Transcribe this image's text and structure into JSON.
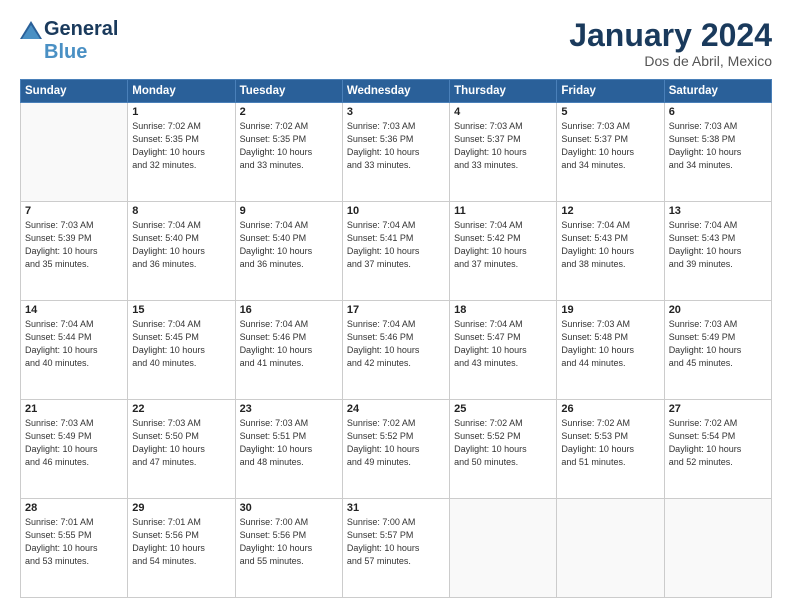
{
  "header": {
    "logo_general": "General",
    "logo_blue": "Blue",
    "month_title": "January 2024",
    "location": "Dos de Abril, Mexico"
  },
  "days_of_week": [
    "Sunday",
    "Monday",
    "Tuesday",
    "Wednesday",
    "Thursday",
    "Friday",
    "Saturday"
  ],
  "weeks": [
    [
      {
        "num": "",
        "sunrise": "",
        "sunset": "",
        "daylight": ""
      },
      {
        "num": "1",
        "sunrise": "Sunrise: 7:02 AM",
        "sunset": "Sunset: 5:35 PM",
        "daylight": "Daylight: 10 hours and 32 minutes."
      },
      {
        "num": "2",
        "sunrise": "Sunrise: 7:02 AM",
        "sunset": "Sunset: 5:35 PM",
        "daylight": "Daylight: 10 hours and 33 minutes."
      },
      {
        "num": "3",
        "sunrise": "Sunrise: 7:03 AM",
        "sunset": "Sunset: 5:36 PM",
        "daylight": "Daylight: 10 hours and 33 minutes."
      },
      {
        "num": "4",
        "sunrise": "Sunrise: 7:03 AM",
        "sunset": "Sunset: 5:37 PM",
        "daylight": "Daylight: 10 hours and 33 minutes."
      },
      {
        "num": "5",
        "sunrise": "Sunrise: 7:03 AM",
        "sunset": "Sunset: 5:37 PM",
        "daylight": "Daylight: 10 hours and 34 minutes."
      },
      {
        "num": "6",
        "sunrise": "Sunrise: 7:03 AM",
        "sunset": "Sunset: 5:38 PM",
        "daylight": "Daylight: 10 hours and 34 minutes."
      }
    ],
    [
      {
        "num": "7",
        "sunrise": "Sunrise: 7:03 AM",
        "sunset": "Sunset: 5:39 PM",
        "daylight": "Daylight: 10 hours and 35 minutes."
      },
      {
        "num": "8",
        "sunrise": "Sunrise: 7:04 AM",
        "sunset": "Sunset: 5:40 PM",
        "daylight": "Daylight: 10 hours and 36 minutes."
      },
      {
        "num": "9",
        "sunrise": "Sunrise: 7:04 AM",
        "sunset": "Sunset: 5:40 PM",
        "daylight": "Daylight: 10 hours and 36 minutes."
      },
      {
        "num": "10",
        "sunrise": "Sunrise: 7:04 AM",
        "sunset": "Sunset: 5:41 PM",
        "daylight": "Daylight: 10 hours and 37 minutes."
      },
      {
        "num": "11",
        "sunrise": "Sunrise: 7:04 AM",
        "sunset": "Sunset: 5:42 PM",
        "daylight": "Daylight: 10 hours and 37 minutes."
      },
      {
        "num": "12",
        "sunrise": "Sunrise: 7:04 AM",
        "sunset": "Sunset: 5:43 PM",
        "daylight": "Daylight: 10 hours and 38 minutes."
      },
      {
        "num": "13",
        "sunrise": "Sunrise: 7:04 AM",
        "sunset": "Sunset: 5:43 PM",
        "daylight": "Daylight: 10 hours and 39 minutes."
      }
    ],
    [
      {
        "num": "14",
        "sunrise": "Sunrise: 7:04 AM",
        "sunset": "Sunset: 5:44 PM",
        "daylight": "Daylight: 10 hours and 40 minutes."
      },
      {
        "num": "15",
        "sunrise": "Sunrise: 7:04 AM",
        "sunset": "Sunset: 5:45 PM",
        "daylight": "Daylight: 10 hours and 40 minutes."
      },
      {
        "num": "16",
        "sunrise": "Sunrise: 7:04 AM",
        "sunset": "Sunset: 5:46 PM",
        "daylight": "Daylight: 10 hours and 41 minutes."
      },
      {
        "num": "17",
        "sunrise": "Sunrise: 7:04 AM",
        "sunset": "Sunset: 5:46 PM",
        "daylight": "Daylight: 10 hours and 42 minutes."
      },
      {
        "num": "18",
        "sunrise": "Sunrise: 7:04 AM",
        "sunset": "Sunset: 5:47 PM",
        "daylight": "Daylight: 10 hours and 43 minutes."
      },
      {
        "num": "19",
        "sunrise": "Sunrise: 7:03 AM",
        "sunset": "Sunset: 5:48 PM",
        "daylight": "Daylight: 10 hours and 44 minutes."
      },
      {
        "num": "20",
        "sunrise": "Sunrise: 7:03 AM",
        "sunset": "Sunset: 5:49 PM",
        "daylight": "Daylight: 10 hours and 45 minutes."
      }
    ],
    [
      {
        "num": "21",
        "sunrise": "Sunrise: 7:03 AM",
        "sunset": "Sunset: 5:49 PM",
        "daylight": "Daylight: 10 hours and 46 minutes."
      },
      {
        "num": "22",
        "sunrise": "Sunrise: 7:03 AM",
        "sunset": "Sunset: 5:50 PM",
        "daylight": "Daylight: 10 hours and 47 minutes."
      },
      {
        "num": "23",
        "sunrise": "Sunrise: 7:03 AM",
        "sunset": "Sunset: 5:51 PM",
        "daylight": "Daylight: 10 hours and 48 minutes."
      },
      {
        "num": "24",
        "sunrise": "Sunrise: 7:02 AM",
        "sunset": "Sunset: 5:52 PM",
        "daylight": "Daylight: 10 hours and 49 minutes."
      },
      {
        "num": "25",
        "sunrise": "Sunrise: 7:02 AM",
        "sunset": "Sunset: 5:52 PM",
        "daylight": "Daylight: 10 hours and 50 minutes."
      },
      {
        "num": "26",
        "sunrise": "Sunrise: 7:02 AM",
        "sunset": "Sunset: 5:53 PM",
        "daylight": "Daylight: 10 hours and 51 minutes."
      },
      {
        "num": "27",
        "sunrise": "Sunrise: 7:02 AM",
        "sunset": "Sunset: 5:54 PM",
        "daylight": "Daylight: 10 hours and 52 minutes."
      }
    ],
    [
      {
        "num": "28",
        "sunrise": "Sunrise: 7:01 AM",
        "sunset": "Sunset: 5:55 PM",
        "daylight": "Daylight: 10 hours and 53 minutes."
      },
      {
        "num": "29",
        "sunrise": "Sunrise: 7:01 AM",
        "sunset": "Sunset: 5:56 PM",
        "daylight": "Daylight: 10 hours and 54 minutes."
      },
      {
        "num": "30",
        "sunrise": "Sunrise: 7:00 AM",
        "sunset": "Sunset: 5:56 PM",
        "daylight": "Daylight: 10 hours and 55 minutes."
      },
      {
        "num": "31",
        "sunrise": "Sunrise: 7:00 AM",
        "sunset": "Sunset: 5:57 PM",
        "daylight": "Daylight: 10 hours and 57 minutes."
      },
      {
        "num": "",
        "sunrise": "",
        "sunset": "",
        "daylight": ""
      },
      {
        "num": "",
        "sunrise": "",
        "sunset": "",
        "daylight": ""
      },
      {
        "num": "",
        "sunrise": "",
        "sunset": "",
        "daylight": ""
      }
    ]
  ]
}
